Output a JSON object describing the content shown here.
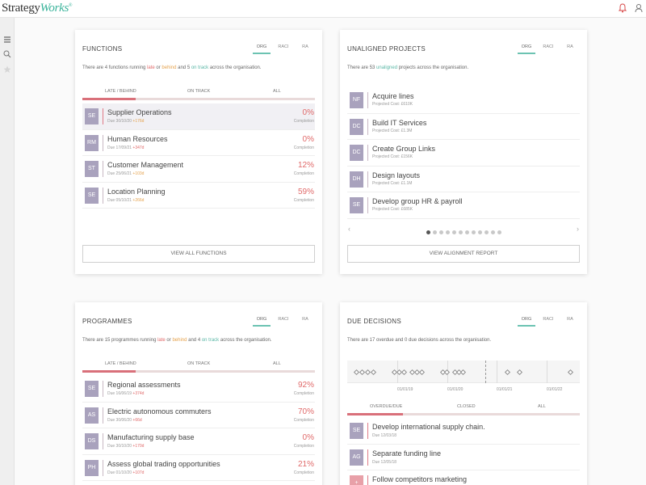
{
  "app": {
    "brand_main": "Strategy",
    "brand_accent": "Works",
    "brand_mark": "®"
  },
  "icons": {
    "notification": "bell-icon",
    "user": "user-icon",
    "menu": "hamburger-icon",
    "search": "search-icon",
    "favourite": "star-icon"
  },
  "colors": {
    "accent": "#39b39a",
    "late": "#e06a6a",
    "behind": "#e5a24d",
    "on_track": "#5ab7a6",
    "avatar": "#a9a2bd"
  },
  "scopes": [
    "ORG",
    "RACI",
    "RA"
  ],
  "functions": {
    "title": "FUNCTIONS",
    "summary": {
      "p1": "There are ",
      "count": "4",
      "p2": " functions running ",
      "late": "late",
      "p3": " or ",
      "behind": "behind",
      "p4": " and ",
      "on_track_count": "5",
      "p5": " ",
      "on_track": "on track",
      "p6": " across the organisation."
    },
    "filters": [
      "LATE / BEHIND",
      "ON TRACK",
      "ALL"
    ],
    "rows": [
      {
        "initials": "SE",
        "name": "Supplier Operations",
        "due": "Due 30/10/20",
        "delta": "+176d",
        "delta_kind": "amb",
        "pct": "0%",
        "pct_kind": "red",
        "pct_label": "Completion"
      },
      {
        "initials": "RM",
        "name": "Human Resources",
        "due": "Due 17/09/21",
        "delta": "+347d",
        "delta_kind": "red",
        "pct": "0%",
        "pct_kind": "red",
        "pct_label": "Completion"
      },
      {
        "initials": "ST",
        "name": "Customer Management",
        "due": "Due 25/06/21",
        "delta": "+103d",
        "delta_kind": "amb",
        "pct": "12%",
        "pct_kind": "red",
        "pct_label": "Completion"
      },
      {
        "initials": "SE",
        "name": "Location Planning",
        "due": "Due 05/10/21",
        "delta": "+266d",
        "delta_kind": "amb",
        "pct": "59%",
        "pct_kind": "red",
        "pct_label": "Completion"
      }
    ],
    "button": "VIEW ALL FUNCTIONS"
  },
  "unaligned": {
    "title": "UNALIGNED PROJECTS",
    "summary": {
      "p1": "There are ",
      "count": "53",
      "p2": " ",
      "word": "unaligned",
      "p3": " projects across the organisation."
    },
    "rows": [
      {
        "initials": "NF",
        "name": "Acquire lines",
        "cost": "Projected Cost: £610K"
      },
      {
        "initials": "DC",
        "name": "Build IT Services",
        "cost": "Projected Cost: £1.3M"
      },
      {
        "initials": "DC",
        "name": "Create Group Links",
        "cost": "Projected Cost: £156K"
      },
      {
        "initials": "DH",
        "name": "Design layouts",
        "cost": "Projected Cost: £1.1M"
      },
      {
        "initials": "SE",
        "name": "Develop group HR & payroll",
        "cost": "Projected Cost: £685K"
      }
    ],
    "pager": {
      "count": 12,
      "active": 0
    },
    "prev": "‹",
    "next": "›",
    "button": "VIEW ALIGNMENT REPORT"
  },
  "programmes": {
    "title": "PROGRAMMES",
    "summary": {
      "p1": "There are ",
      "count": "15",
      "p2": " programmes running ",
      "late": "late",
      "p3": " or ",
      "behind": "behind",
      "p4": " and ",
      "on_track_count": "4",
      "p5": " ",
      "on_track": "on track",
      "p6": " across the organisation."
    },
    "filters": [
      "LATE / BEHIND",
      "ON TRACK",
      "ALL"
    ],
    "rows": [
      {
        "initials": "SE",
        "name": "Regional assessments",
        "due": "Due 16/06/19",
        "delta": "+374d",
        "delta_kind": "red",
        "pct": "92%",
        "pct_kind": "red",
        "pct_label": "Completion"
      },
      {
        "initials": "AS",
        "name": "Electric autonomous commuters",
        "due": "Due 30/06/20",
        "delta": "+66d",
        "delta_kind": "red",
        "pct": "70%",
        "pct_kind": "red",
        "pct_label": "Completion"
      },
      {
        "initials": "DS",
        "name": "Manufacturing supply base",
        "due": "Due 30/10/20",
        "delta": "+170d",
        "delta_kind": "red",
        "pct": "0%",
        "pct_kind": "red",
        "pct_label": "Completion"
      },
      {
        "initials": "PH",
        "name": "Assess global trading opportunities",
        "due": "Due 01/10/20",
        "delta": "+107d",
        "delta_kind": "red",
        "pct": "21%",
        "pct_kind": "red",
        "pct_label": "Completion"
      }
    ]
  },
  "decisions": {
    "title": "DUE DECISIONS",
    "summary": {
      "text": "There are 17 overdue and 0 due decisions across the organisation."
    },
    "timeline_ticks": [
      "01/01/19",
      "01/01/20",
      "01/01/21",
      "01/01/22"
    ],
    "filters": [
      "OVERDUE/DUE",
      "CLOSED",
      "ALL"
    ],
    "rows": [
      {
        "initials": "SE",
        "name": "Develop international supply chain.",
        "due": "Due 12/03/18"
      },
      {
        "initials": "AG",
        "name": "Separate funding line",
        "due": "Due 12/05/18"
      },
      {
        "initials": "+",
        "name": "Follow competitors marketing",
        "due": ""
      }
    ]
  }
}
